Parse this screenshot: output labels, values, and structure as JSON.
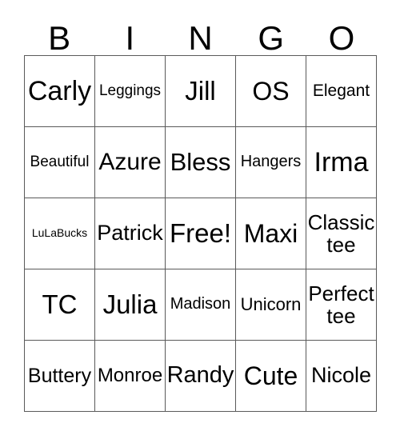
{
  "card": {
    "headers": [
      "B",
      "I",
      "N",
      "G",
      "O"
    ],
    "rows": [
      [
        {
          "text": "Carly",
          "size": 34
        },
        {
          "text": "Leggings",
          "size": 19
        },
        {
          "text": "Jill",
          "size": 33
        },
        {
          "text": "OS",
          "size": 32
        },
        {
          "text": "Elegant",
          "size": 21
        }
      ],
      [
        {
          "text": "Beautiful",
          "size": 19
        },
        {
          "text": "Azure",
          "size": 30
        },
        {
          "text": "Bless",
          "size": 31
        },
        {
          "text": "Hangers",
          "size": 20
        },
        {
          "text": "Irma",
          "size": 34
        }
      ],
      [
        {
          "text": "LuLaBucks",
          "size": 14
        },
        {
          "text": "Patrick",
          "size": 27
        },
        {
          "text": "Free!",
          "size": 33
        },
        {
          "text": "Maxi",
          "size": 32
        },
        {
          "text": "Classic tee",
          "size": 26
        }
      ],
      [
        {
          "text": "TC",
          "size": 33
        },
        {
          "text": "Julia",
          "size": 33
        },
        {
          "text": "Madison",
          "size": 20
        },
        {
          "text": "Unicorn",
          "size": 22
        },
        {
          "text": "Perfect tee",
          "size": 26
        }
      ],
      [
        {
          "text": "Buttery",
          "size": 25
        },
        {
          "text": "Monroe",
          "size": 24
        },
        {
          "text": "Randy",
          "size": 29
        },
        {
          "text": "Cute",
          "size": 32
        },
        {
          "text": "Nicole",
          "size": 27
        }
      ]
    ],
    "free_space": {
      "row": 2,
      "col": 2,
      "label": "Free!"
    },
    "colors": {
      "background": "#ffffff",
      "text": "#000000",
      "grid_line": "#5a5a5a"
    }
  }
}
